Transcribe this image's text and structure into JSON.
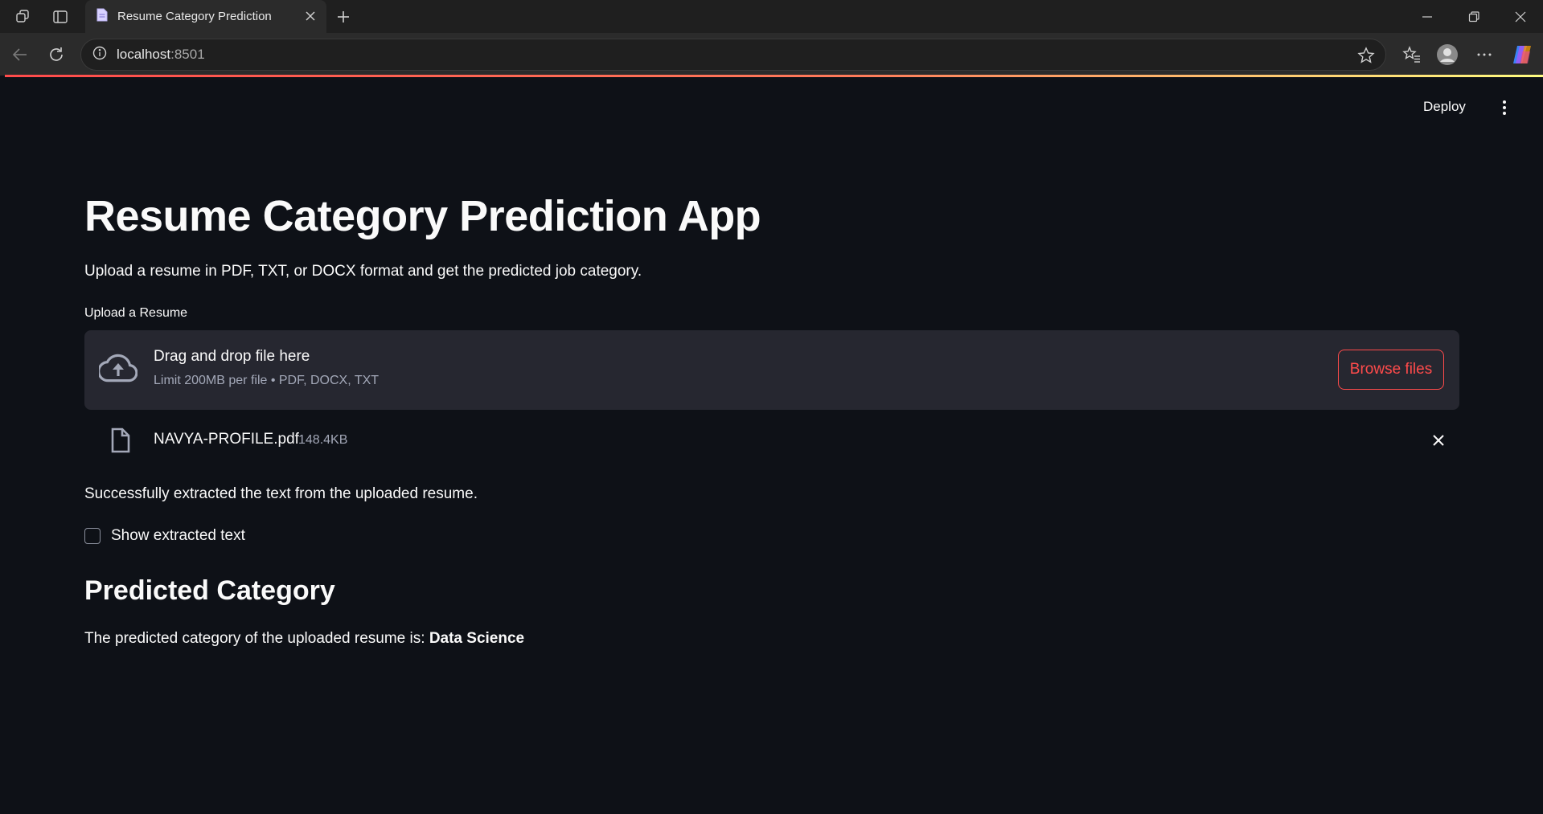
{
  "browser": {
    "tab_title": "Resume Category Prediction",
    "address_host": "localhost",
    "address_port": ":8501"
  },
  "app": {
    "deploy_label": "Deploy",
    "title": "Resume Category Prediction App",
    "subtitle": "Upload a resume in PDF, TXT, or DOCX format and get the predicted job category.",
    "uploader": {
      "label": "Upload a Resume",
      "drop_title": "Drag and drop file here",
      "limit_text": "Limit 200MB per file • PDF, DOCX, TXT",
      "browse_label": "Browse files"
    },
    "uploaded_file": {
      "name": "NAVYA-PROFILE.pdf",
      "size": "148.4KB"
    },
    "success_message": "Successfully extracted the text from the uploaded resume.",
    "show_text_checkbox": {
      "label": "Show extracted text",
      "checked": false
    },
    "prediction": {
      "heading": "Predicted Category",
      "text": "The predicted category of the uploaded resume is:",
      "category": "Data Science"
    }
  },
  "colors": {
    "background": "#0e1117",
    "surface": "#262730",
    "accent": "#ff4b4b",
    "muted_text": "#a3a8b8"
  },
  "icons": [
    "workspaces-icon",
    "tab-actions-icon",
    "page-icon",
    "close-icon",
    "plus-icon",
    "minimize-icon",
    "restore-icon",
    "window-close-icon",
    "back-icon",
    "refresh-icon",
    "info-icon",
    "star-icon",
    "favorites-icon",
    "profile-icon",
    "more-icon",
    "copilot-icon",
    "kebab-menu-icon",
    "cloud-upload-icon",
    "file-icon"
  ]
}
